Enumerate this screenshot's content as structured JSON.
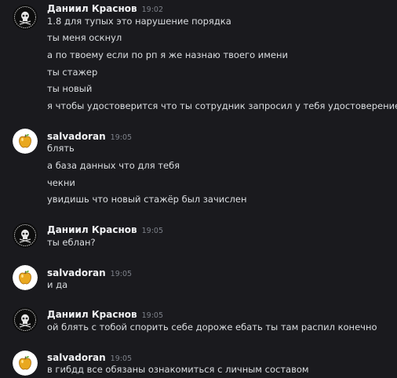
{
  "messages": [
    {
      "author": "Даниил Краснов",
      "time": "19:02",
      "avatar_icon": "skull-emblem-icon",
      "lines": [
        "1.8 для тупых это нарушение порядка",
        "ты меня оскнул",
        "а по твоему если по рп я же назнаю твоего имени",
        "ты стажер",
        "ты новый",
        "я чтобы удостоверится что ты сотрудник запросил у тебя удостоверение"
      ]
    },
    {
      "author": "salvadoran",
      "time": "19:05",
      "avatar_icon": "golden-apple-icon",
      "lines": [
        "блять",
        "а база данных что для тебя",
        "чекни",
        "увидишь что новый стажёр был зачислен"
      ]
    },
    {
      "author": "Даниил Краснов",
      "time": "19:05",
      "avatar_icon": "skull-emblem-icon",
      "lines": [
        "ты еблан?"
      ]
    },
    {
      "author": "salvadoran",
      "time": "19:05",
      "avatar_icon": "golden-apple-icon",
      "lines": [
        "и да"
      ]
    },
    {
      "author": "Даниил Краснов",
      "time": "19:05",
      "avatar_icon": "skull-emblem-icon",
      "lines": [
        "ой блять с тобой спорить себе дороже ебать ты там распил конечно"
      ]
    },
    {
      "author": "salvadoran",
      "time": "19:05",
      "avatar_icon": "golden-apple-icon",
      "lines": [
        "в гибдд все обязаны ознакомиться с личным составом"
      ]
    }
  ],
  "colors": {
    "background": "#1a1a1e",
    "author": "#f2f3f5",
    "text": "#dbdee1",
    "timestamp": "#7d8189"
  }
}
